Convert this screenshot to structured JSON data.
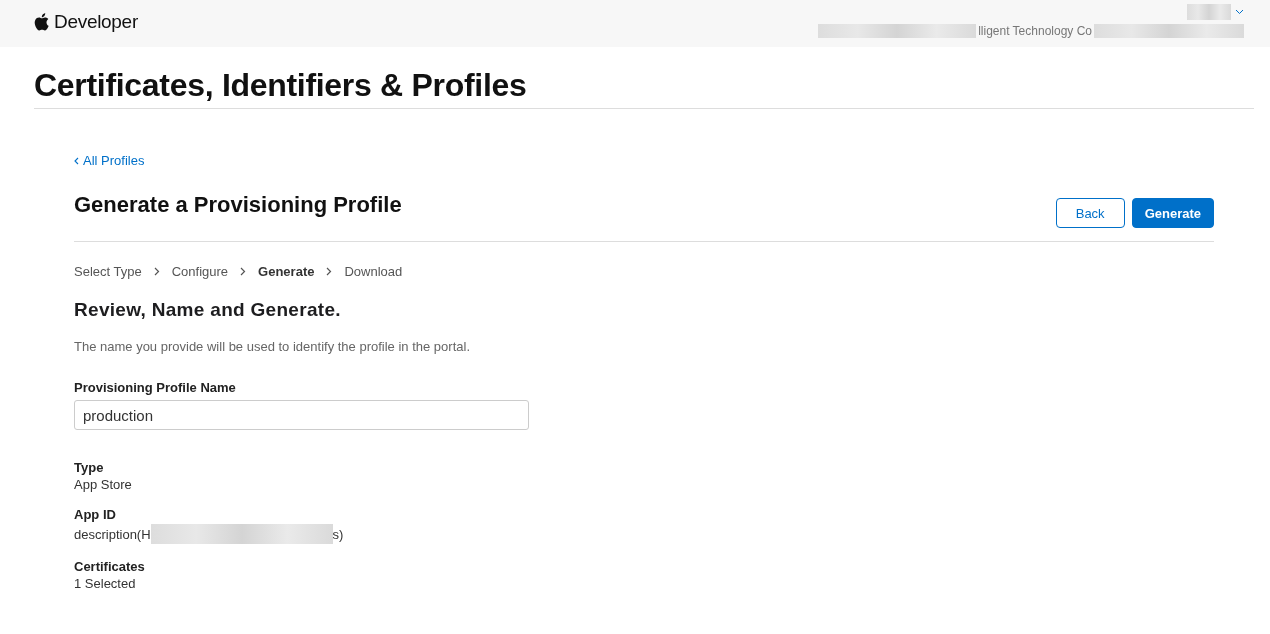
{
  "header": {
    "brand": "Developer",
    "account_org": "lligent Technology Co"
  },
  "page_title": "Certificates, Identifiers & Profiles",
  "back_link": "All Profiles",
  "section_title": "Generate a Provisioning Profile",
  "buttons": [
    {
      "label": "Back",
      "kind": "secondary"
    },
    {
      "label": "Generate",
      "kind": "primary"
    }
  ],
  "steps": [
    {
      "label": "Select Type",
      "selected": false
    },
    {
      "label": "Configure",
      "selected": false
    },
    {
      "label": "Generate",
      "selected": true
    },
    {
      "label": "Download",
      "selected": false
    }
  ],
  "form_title": "Review, Name and Generate.",
  "description": "The name you provide will be used to identify the profile in the portal.",
  "name_field": {
    "label": "Provisioning Profile Name",
    "value": "production"
  },
  "details": [
    {
      "label": "Type",
      "value": "App Store"
    },
    {
      "label": "App ID",
      "value": "description(H",
      "redacted_tail": "s)"
    },
    {
      "label": "Certificates",
      "value": "1 Selected"
    }
  ]
}
